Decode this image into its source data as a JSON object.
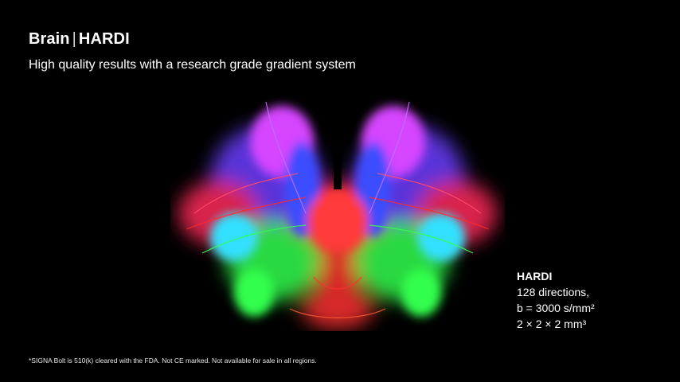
{
  "header": {
    "title_main": "Brain",
    "title_separator": "|",
    "title_sub": "HARDI",
    "subtitle": "High quality results with a research grade gradient system"
  },
  "image": {
    "icon": "brain-tractography-image"
  },
  "specs": {
    "title": "HARDI",
    "lines": [
      "128 directions,",
      "b = 3000 s/mm²",
      "2 × 2 × 2 mm³"
    ]
  },
  "footnote": "*SIGNA Bolt is 510(k) cleared with the FDA. Not CE marked. Not available for sale in all regions.",
  "colors": {
    "background": "#000000",
    "text": "#ffffff",
    "fiber_red": "#ff2a2a",
    "fiber_green": "#33ff4d",
    "fiber_blue": "#3b4dff",
    "fiber_magenta": "#d645ff",
    "fiber_cyan": "#33e0ff"
  }
}
